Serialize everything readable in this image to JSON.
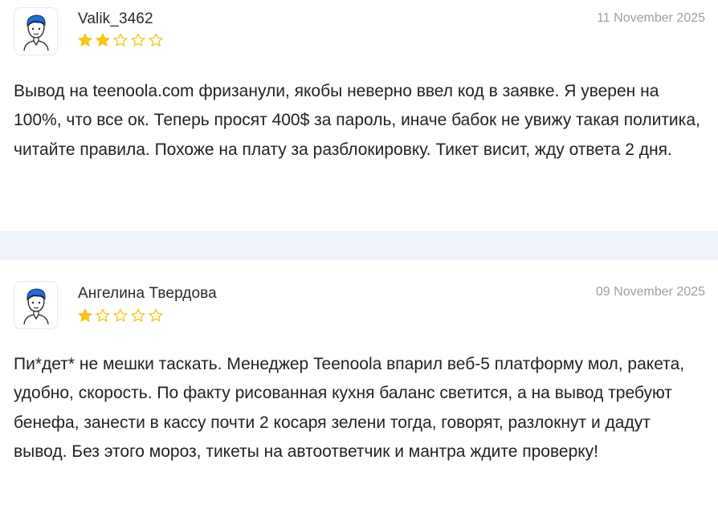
{
  "reviews": [
    {
      "author": "Valik_3462",
      "date": "11 November 2025",
      "rating": 2,
      "max_rating": 5,
      "text": "Вывод на teenoola.com фризанули, якобы неверно ввел код в заявке. Я уверен на 100%, что все ок. Теперь просят 400$ за пароль, иначе бабок не увижу такая политика, читайте правила. Похоже на плату за разблокировку. Тикет висит, жду ответа 2 дня."
    },
    {
      "author": "Ангелина Твердова",
      "date": "09 November 2025",
      "rating": 1,
      "max_rating": 5,
      "text": "Пи*дет* не мешки таскать. Менеджер Teenoola впарил веб-5 платформу мол, ракета, удобно, скорость. По факту рисованная кухня баланс светится, а на вывод требуют бенефа, занести в кассу почти 2 косаря зелени тогда, говорят, разлокнут и дадут вывод. Без этого мороз, тикеты на автоответчик и мантра ждите проверку!"
    }
  ],
  "icons": {
    "avatar": "user-avatar-icon",
    "star_filled": "star-filled-icon",
    "star_empty": "star-empty-icon"
  },
  "colors": {
    "star_filled": "#f5c518",
    "star_outline": "#f5c518",
    "divider": "#eef2f9",
    "date": "#9aa0a8",
    "avatar_hair": "#1e6fe0"
  }
}
